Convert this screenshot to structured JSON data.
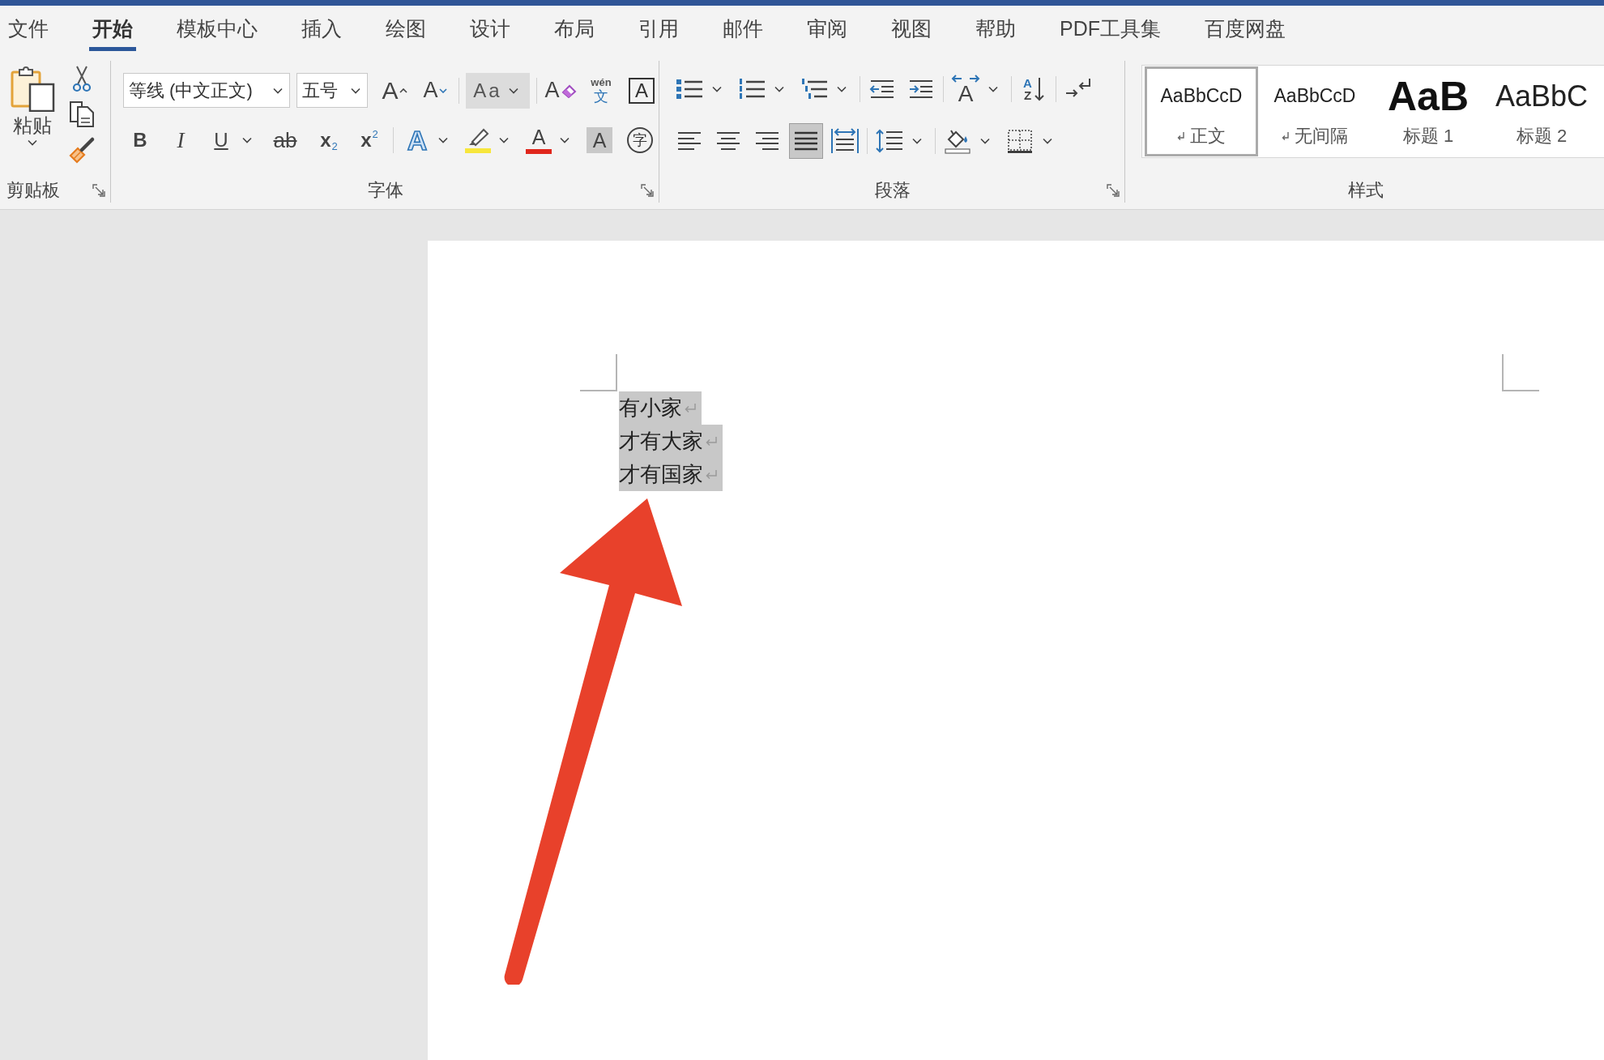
{
  "tabs": [
    {
      "label": "文件",
      "selected": false
    },
    {
      "label": "开始",
      "selected": true
    },
    {
      "label": "模板中心",
      "selected": false
    },
    {
      "label": "插入",
      "selected": false
    },
    {
      "label": "绘图",
      "selected": false
    },
    {
      "label": "设计",
      "selected": false
    },
    {
      "label": "布局",
      "selected": false
    },
    {
      "label": "引用",
      "selected": false
    },
    {
      "label": "邮件",
      "selected": false
    },
    {
      "label": "审阅",
      "selected": false
    },
    {
      "label": "视图",
      "selected": false
    },
    {
      "label": "帮助",
      "selected": false
    },
    {
      "label": "PDF工具集",
      "selected": false
    },
    {
      "label": "百度网盘",
      "selected": false
    }
  ],
  "ribbon": {
    "clipboard": {
      "paste": {
        "label": "粘贴",
        "dropdown": true
      },
      "tools": [
        {
          "kind": "cut"
        },
        {
          "kind": "copy"
        },
        {
          "kind": "format_painter"
        }
      ],
      "group_label": "剪贴板",
      "launcher": true
    },
    "font": {
      "font_name": "等线 (中文正文)",
      "font_size": "五号",
      "row_1": [
        [
          {
            "kind": "grow_font",
            "glyph": "A",
            "dropdown": false,
            "hovered": false
          },
          {
            "kind": "shrink_font",
            "glyph": "A",
            "dropdown": false,
            "hovered": false
          }
        ],
        [
          {
            "kind": "change_case",
            "glyph": "Aa",
            "dropdown": true,
            "hovered": true
          }
        ],
        [
          {
            "kind": "clear_formatting",
            "glyph": "A",
            "dropdown": false,
            "hovered": false
          },
          {
            "kind": "phonetic_guide",
            "glyph": "wén",
            "glyph_2": "文",
            "dropdown": false,
            "hovered": false
          },
          {
            "kind": "character_border",
            "glyph": "A",
            "dropdown": false,
            "hovered": false
          }
        ]
      ],
      "row_2": [
        [
          {
            "kind": "bold",
            "glyph": "B",
            "dropdown": false,
            "hovered": false
          },
          {
            "kind": "italic",
            "glyph": "I",
            "dropdown": false,
            "hovered": false
          },
          {
            "kind": "underline",
            "glyph": "U",
            "dropdown": true,
            "hovered": false
          },
          {
            "kind": "strikethrough",
            "glyph": "ab",
            "dropdown": false,
            "hovered": false
          },
          {
            "kind": "subscript",
            "glyph": "x",
            "glyph_2": "2",
            "dropdown": false,
            "hovered": false
          },
          {
            "kind": "superscript",
            "glyph": "x",
            "glyph_2": "2",
            "dropdown": false,
            "hovered": false
          }
        ],
        [
          {
            "kind": "text_effects",
            "glyph": "A",
            "dropdown": true,
            "hovered": false
          },
          {
            "kind": "highlight",
            "color": "#f7e63b",
            "dropdown": true,
            "hovered": false
          },
          {
            "kind": "font_color",
            "glyph": "A",
            "color": "#e0261c",
            "dropdown": true,
            "hovered": false
          },
          {
            "kind": "character_shading",
            "glyph": "A",
            "dropdown": false,
            "hovered": false
          },
          {
            "kind": "enclose_characters",
            "glyph": "字",
            "dropdown": false,
            "hovered": false
          }
        ]
      ],
      "group_label": "字体",
      "launcher": true
    },
    "paragraph": {
      "row_1": [
        [
          {
            "kind": "bullets",
            "dropdown": true
          },
          {
            "kind": "numbering",
            "dropdown": true
          },
          {
            "kind": "multilevel_list",
            "dropdown": true
          }
        ],
        [
          {
            "kind": "decrease_indent",
            "dropdown": false
          },
          {
            "kind": "increase_indent",
            "dropdown": false
          }
        ],
        [
          {
            "kind": "asian_layout",
            "glyph": "A",
            "dropdown": true
          }
        ],
        [
          {
            "kind": "sort",
            "glyph": "A",
            "glyph_2": "Z",
            "dropdown": false
          }
        ],
        [
          {
            "kind": "return_arrows",
            "dropdown": false
          }
        ]
      ],
      "row_2": [
        [
          {
            "kind": "align_left",
            "selected": false,
            "dropdown": false
          },
          {
            "kind": "align_center",
            "selected": false,
            "dropdown": false
          },
          {
            "kind": "align_right",
            "selected": false,
            "dropdown": false
          },
          {
            "kind": "justify",
            "selected": true,
            "dropdown": false
          },
          {
            "kind": "distributed",
            "selected": false,
            "dropdown": false
          }
        ],
        [
          {
            "kind": "line_spacing",
            "dropdown": true
          }
        ],
        [
          {
            "kind": "shading",
            "dropdown": true
          },
          {
            "kind": "borders",
            "dropdown": true
          }
        ]
      ],
      "group_label": "段落",
      "launcher": true
    },
    "styles": {
      "gallery": [
        {
          "kind": "body",
          "sample": "AaBbCcD",
          "label": "正文",
          "paragraph_mark": true,
          "selected": true
        },
        {
          "kind": "no_spacing",
          "sample": "AaBbCcD",
          "label": "无间隔",
          "paragraph_mark": true,
          "selected": false
        },
        {
          "kind": "heading_1",
          "sample": "AaB",
          "label": "标题 1",
          "paragraph_mark": false,
          "selected": false
        },
        {
          "kind": "heading_2",
          "sample": "AaBbC",
          "label": "标题 2",
          "paragraph_mark": false,
          "selected": false
        }
      ],
      "group_label": "样式"
    }
  },
  "document": {
    "paragraphs": [
      {
        "text": "有小家",
        "selected": true
      },
      {
        "text": "才有大家",
        "selected": true
      },
      {
        "text": "才有国家",
        "selected": true
      }
    ]
  }
}
